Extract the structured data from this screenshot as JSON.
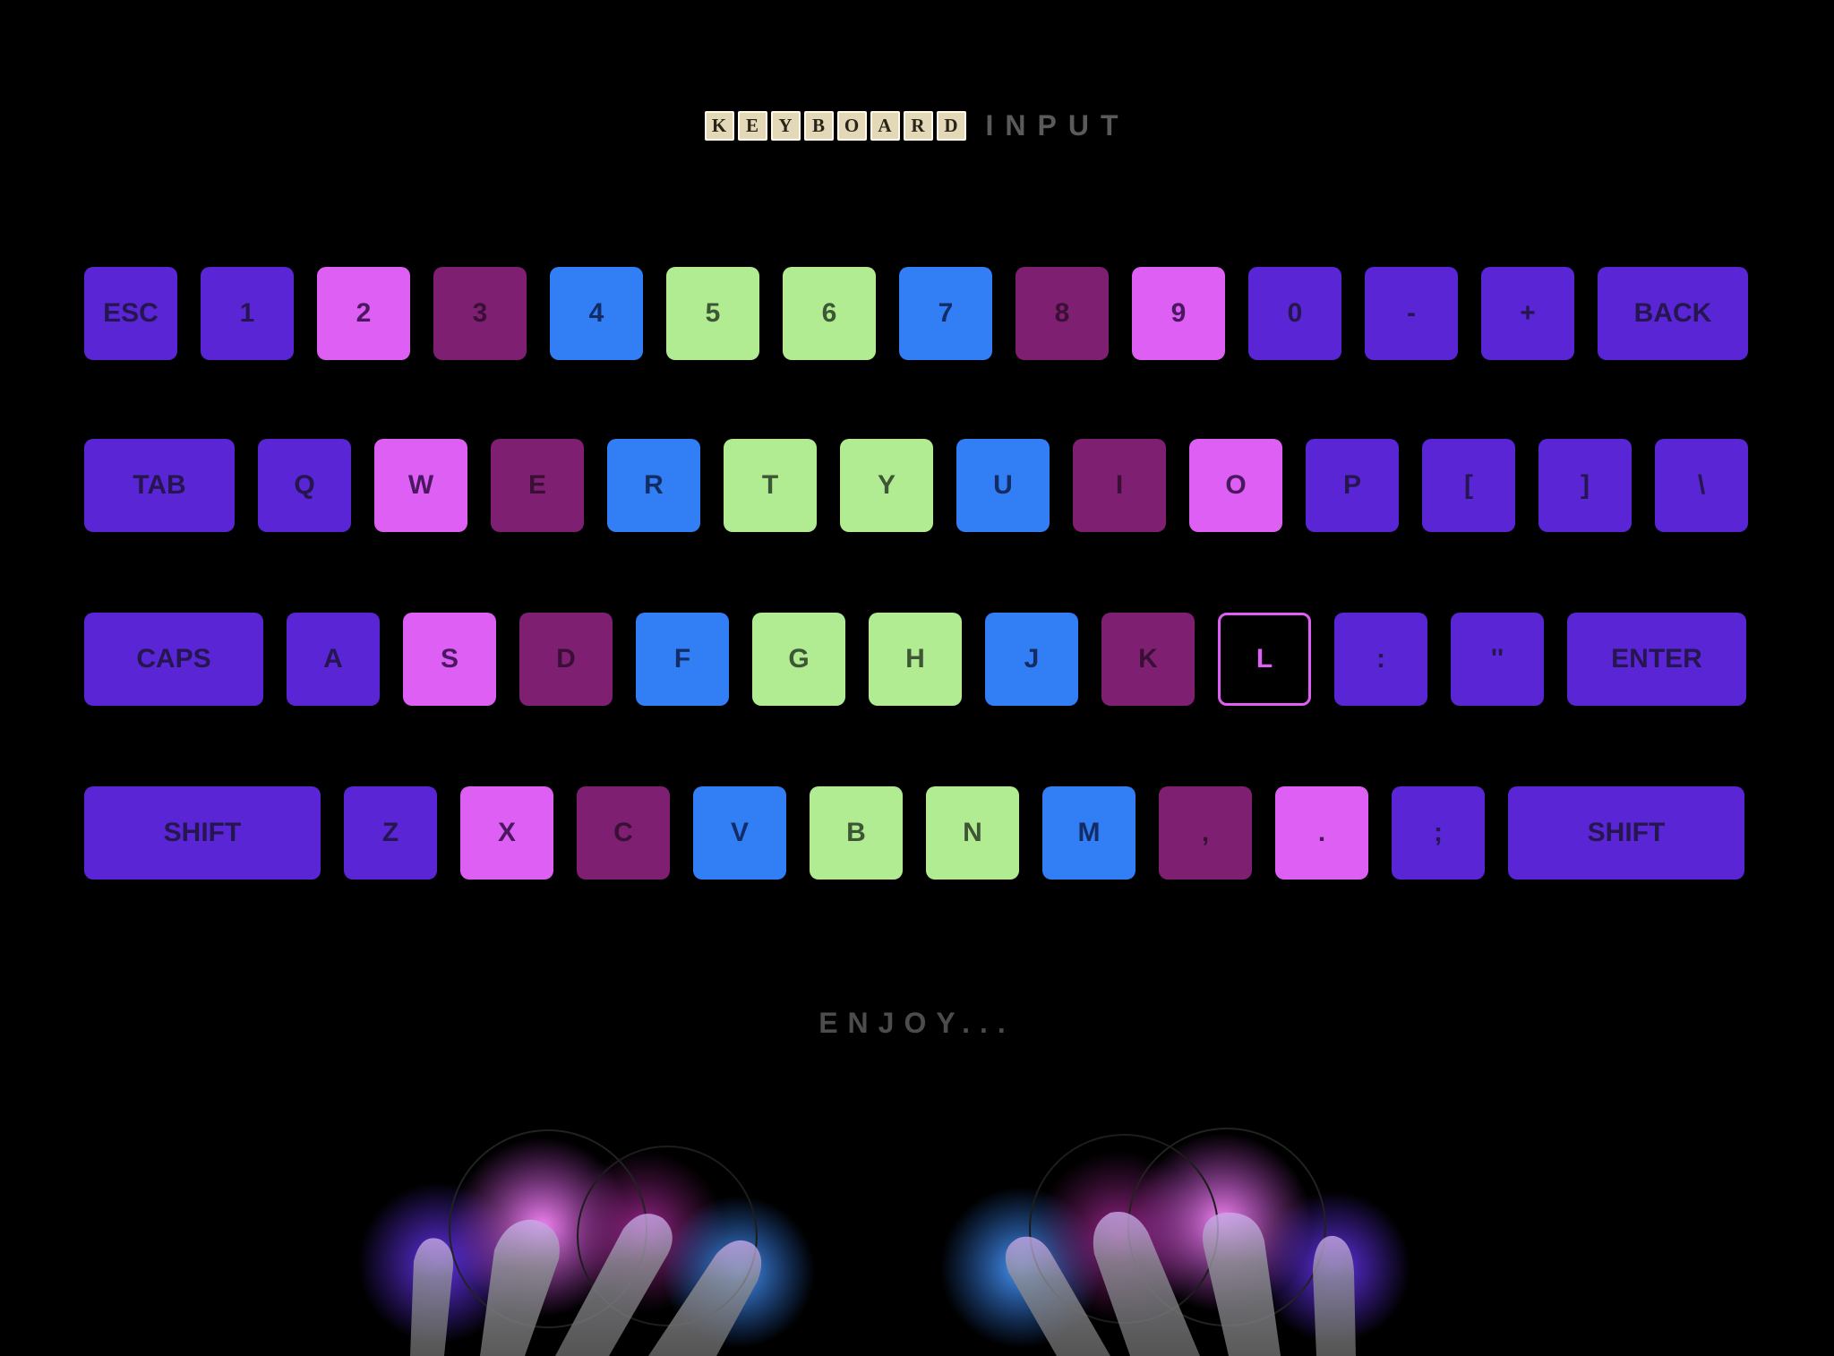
{
  "title": {
    "tile_letters": [
      "K",
      "E",
      "Y",
      "B",
      "O",
      "A",
      "R",
      "D"
    ],
    "word": "INPUT"
  },
  "palette": {
    "indigo": "#5a25d4",
    "pink": "#dd5ff3",
    "plum": "#7f1f72",
    "blue": "#327ef5",
    "lime": "#b1ec92",
    "background": "#000000"
  },
  "keyboard": {
    "rows": [
      {
        "keys": [
          {
            "label": "ESC",
            "color": "indigo"
          },
          {
            "label": "1",
            "color": "indigo"
          },
          {
            "label": "2",
            "color": "pink"
          },
          {
            "label": "3",
            "color": "plum"
          },
          {
            "label": "4",
            "color": "blue"
          },
          {
            "label": "5",
            "color": "lime"
          },
          {
            "label": "6",
            "color": "lime"
          },
          {
            "label": "7",
            "color": "blue"
          },
          {
            "label": "8",
            "color": "plum"
          },
          {
            "label": "9",
            "color": "pink"
          },
          {
            "label": "0",
            "color": "indigo"
          },
          {
            "label": "-",
            "color": "indigo"
          },
          {
            "label": "+",
            "color": "indigo"
          },
          {
            "label": "BACK",
            "color": "indigo"
          }
        ]
      },
      {
        "keys": [
          {
            "label": "TAB",
            "color": "indigo"
          },
          {
            "label": "Q",
            "color": "indigo"
          },
          {
            "label": "W",
            "color": "pink"
          },
          {
            "label": "E",
            "color": "plum"
          },
          {
            "label": "R",
            "color": "blue"
          },
          {
            "label": "T",
            "color": "lime"
          },
          {
            "label": "Y",
            "color": "lime"
          },
          {
            "label": "U",
            "color": "blue"
          },
          {
            "label": "I",
            "color": "plum"
          },
          {
            "label": "O",
            "color": "pink"
          },
          {
            "label": "P",
            "color": "indigo"
          },
          {
            "label": "[",
            "color": "indigo"
          },
          {
            "label": "]",
            "color": "indigo"
          },
          {
            "label": "\\",
            "color": "indigo"
          }
        ]
      },
      {
        "keys": [
          {
            "label": "CAPS",
            "color": "indigo"
          },
          {
            "label": "A",
            "color": "indigo"
          },
          {
            "label": "S",
            "color": "pink"
          },
          {
            "label": "D",
            "color": "plum"
          },
          {
            "label": "F",
            "color": "blue"
          },
          {
            "label": "G",
            "color": "lime"
          },
          {
            "label": "H",
            "color": "lime"
          },
          {
            "label": "J",
            "color": "blue"
          },
          {
            "label": "K",
            "color": "plum"
          },
          {
            "label": "L",
            "color": "outline",
            "pressed": true
          },
          {
            "label": ":",
            "color": "indigo"
          },
          {
            "label": "''",
            "color": "indigo"
          },
          {
            "label": "ENTER",
            "color": "indigo"
          }
        ]
      },
      {
        "keys": [
          {
            "label": "SHIFT",
            "color": "indigo"
          },
          {
            "label": "Z",
            "color": "indigo"
          },
          {
            "label": "X",
            "color": "pink"
          },
          {
            "label": "C",
            "color": "plum"
          },
          {
            "label": "V",
            "color": "blue"
          },
          {
            "label": "B",
            "color": "lime"
          },
          {
            "label": "N",
            "color": "lime"
          },
          {
            "label": "M",
            "color": "blue"
          },
          {
            "label": ",",
            "color": "plum"
          },
          {
            "label": ".",
            "color": "pink"
          },
          {
            "label": ";",
            "color": "indigo"
          },
          {
            "label": "SHIFT",
            "color": "indigo"
          }
        ]
      }
    ]
  },
  "footer": {
    "text": "ENJOY..."
  }
}
